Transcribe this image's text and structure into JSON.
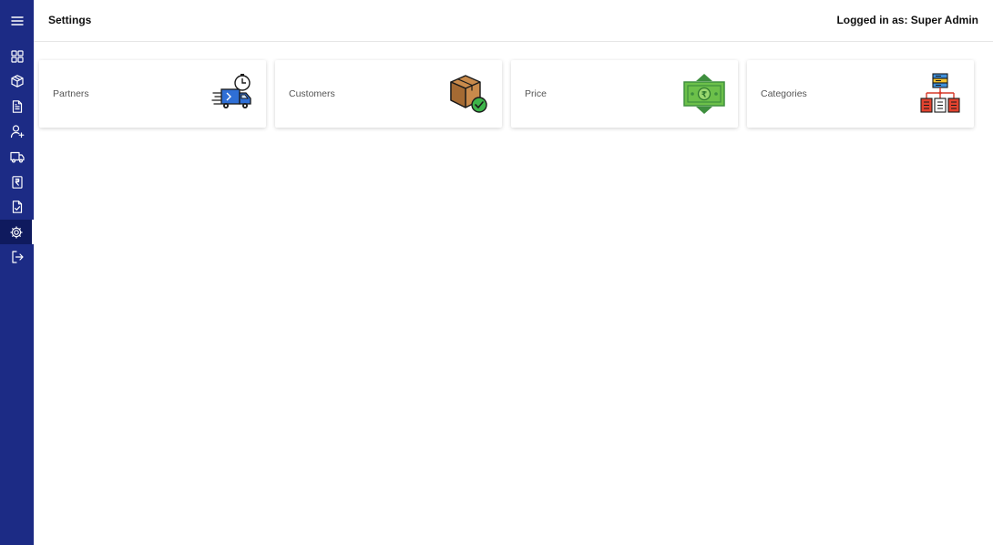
{
  "header": {
    "title": "Settings",
    "login_info": "Logged in as: Super Admin"
  },
  "sidebar": {
    "active_item": "settings",
    "items": [
      {
        "id": "menu",
        "icon": "hamburger-menu-icon"
      },
      {
        "id": "dashboard",
        "icon": "dashboard-grid-icon"
      },
      {
        "id": "products",
        "icon": "box-icon"
      },
      {
        "id": "documents",
        "icon": "document-icon"
      },
      {
        "id": "add-user",
        "icon": "add-user-icon"
      },
      {
        "id": "delivery",
        "icon": "truck-icon"
      },
      {
        "id": "invoice",
        "icon": "invoice-icon"
      },
      {
        "id": "approved",
        "icon": "checked-document-icon"
      },
      {
        "id": "settings",
        "icon": "gear-icon"
      },
      {
        "id": "logout",
        "icon": "logout-icon"
      }
    ]
  },
  "cards": [
    {
      "label": "Partners",
      "icon": "delivery-truck-clock-icon"
    },
    {
      "label": "Customers",
      "icon": "package-check-icon"
    },
    {
      "label": "Price",
      "icon": "rupee-banknote-icon"
    },
    {
      "label": "Categories",
      "icon": "category-hierarchy-icon"
    }
  ],
  "colors": {
    "sidebar": "#1c2b85",
    "sidebar_active": "#0f1a5e",
    "card_shadow": "#cccccc"
  }
}
